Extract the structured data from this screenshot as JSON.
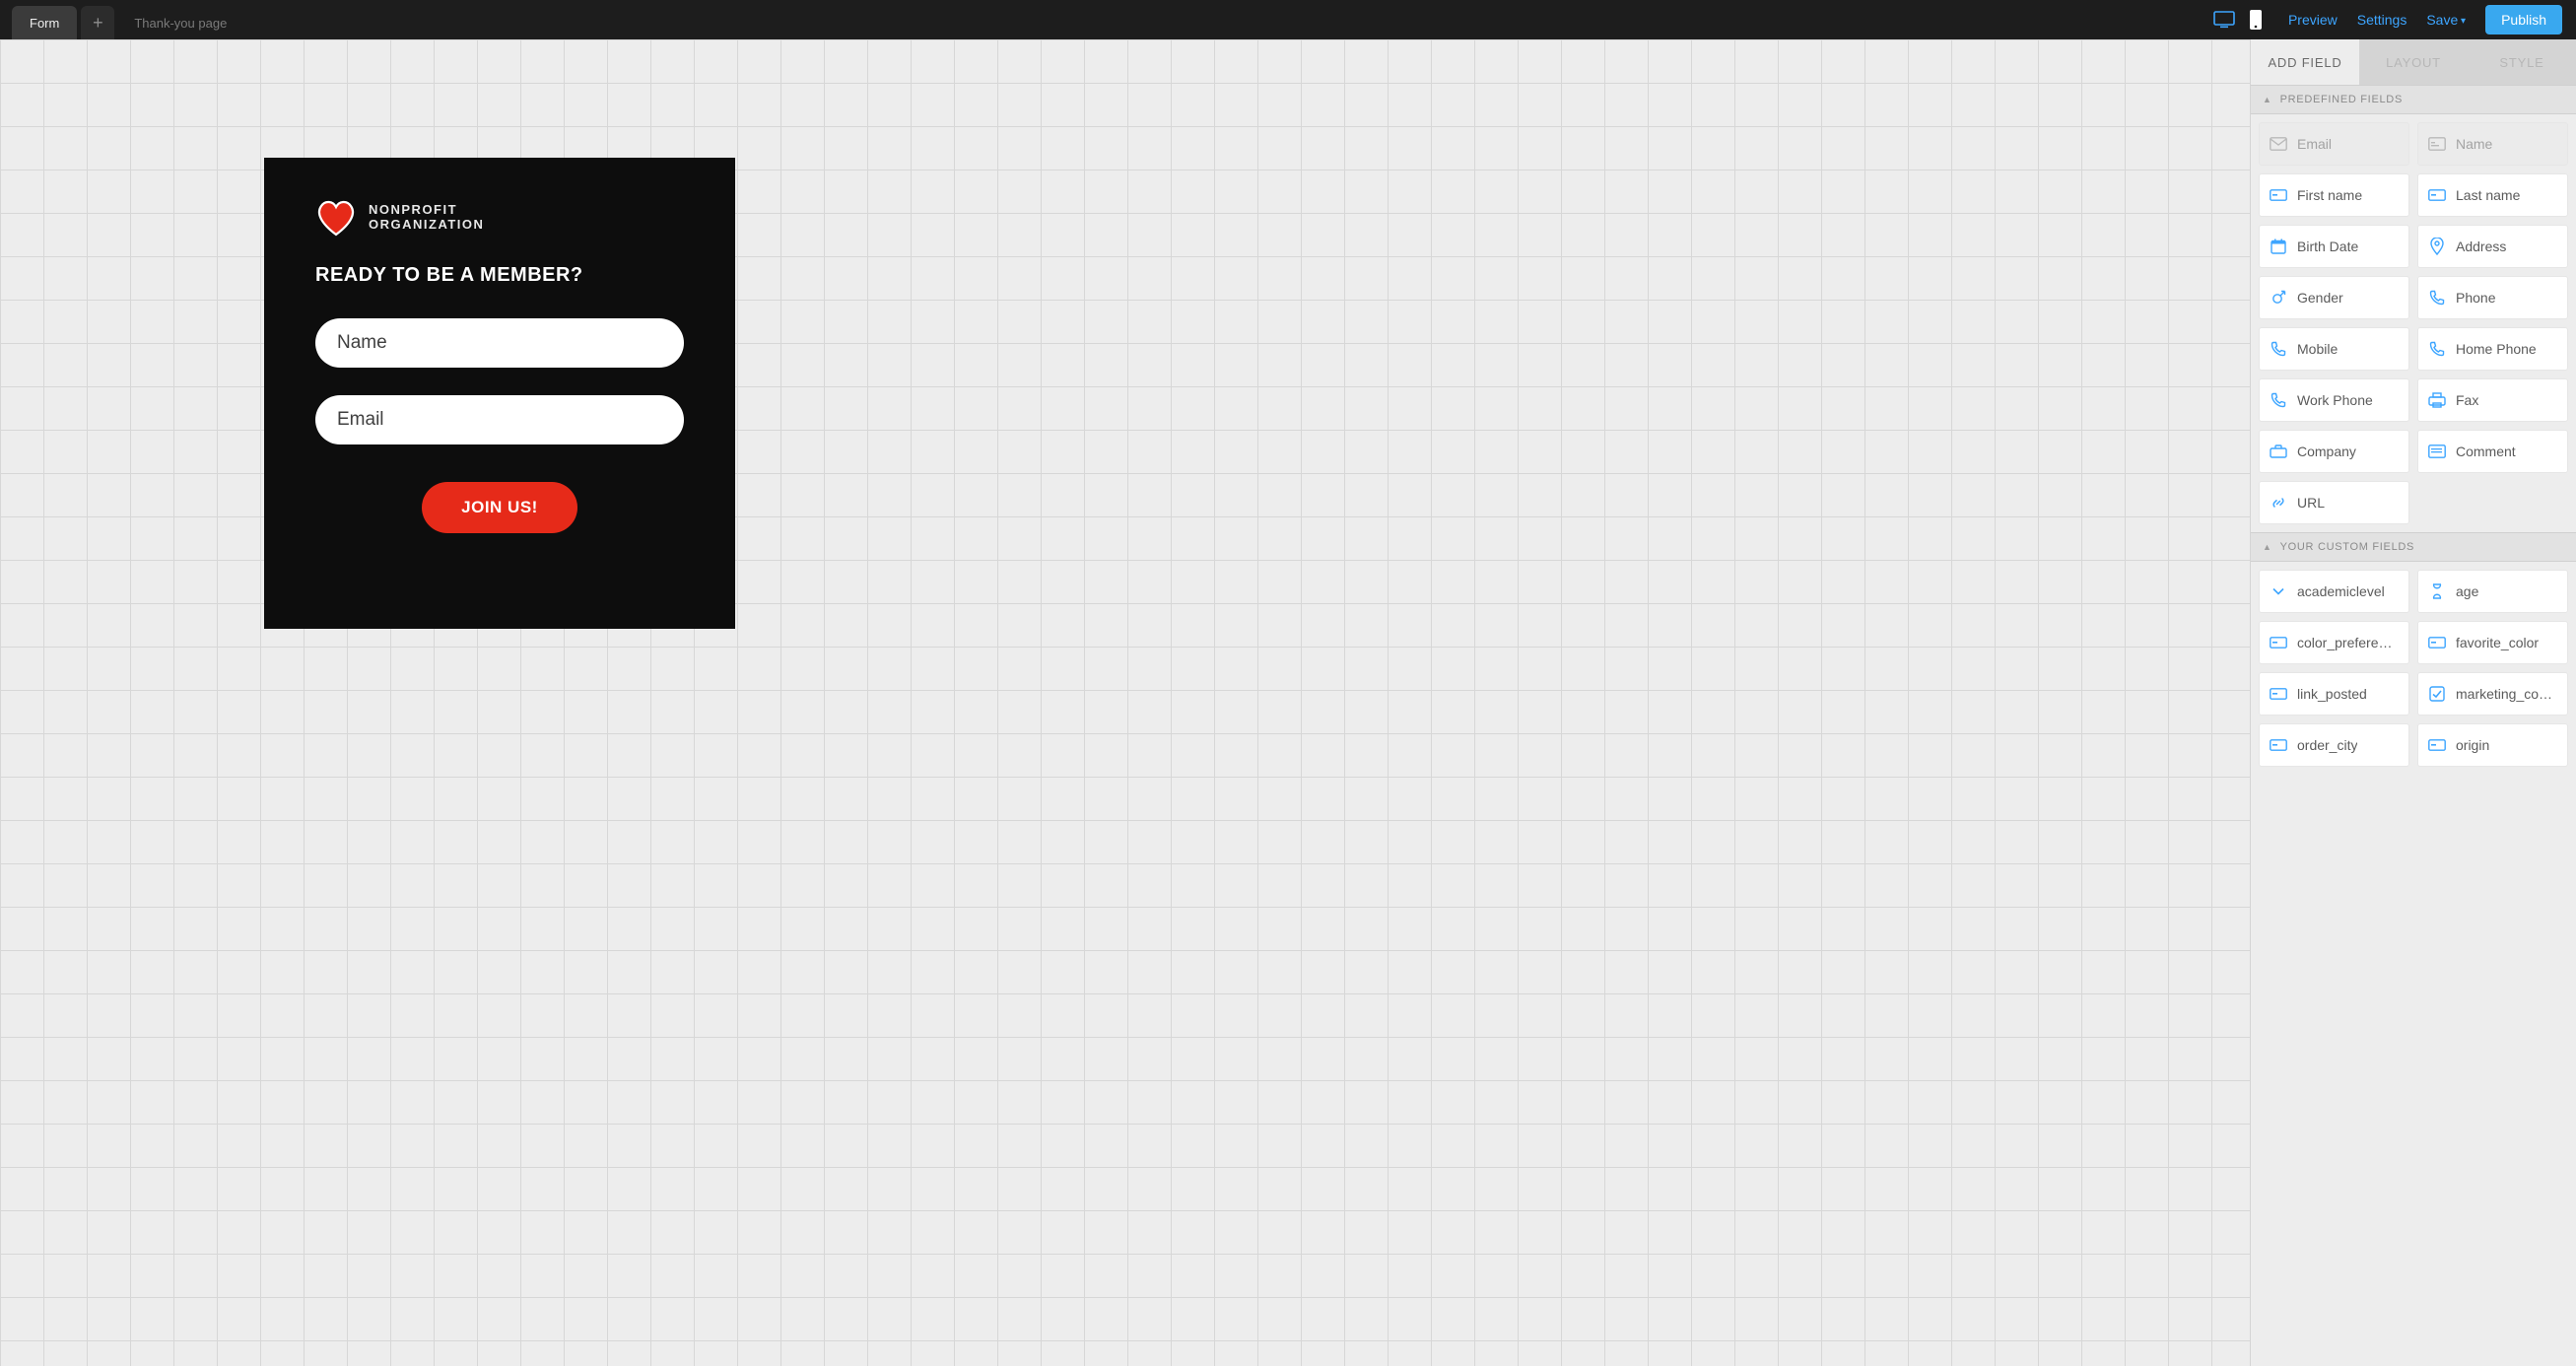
{
  "topbar": {
    "tab_form": "Form",
    "tab_thankyou": "Thank-you page",
    "preview": "Preview",
    "settings": "Settings",
    "save": "Save",
    "publish": "Publish"
  },
  "form_card": {
    "logo_line1": "NONPROFIT",
    "logo_line2": "ORGANIZATION",
    "heading": "READY TO BE A MEMBER?",
    "name_placeholder": "Name",
    "email_placeholder": "Email",
    "cta": "JOIN US!"
  },
  "panel": {
    "tabs": {
      "add_field": "ADD FIELD",
      "layout": "LAYOUT",
      "style": "STYLE"
    },
    "section_predefined": "PREDEFINED FIELDS",
    "section_custom": "YOUR CUSTOM FIELDS",
    "predefined": [
      {
        "label": "Email",
        "icon": "mail",
        "disabled": true
      },
      {
        "label": "Name",
        "icon": "id",
        "disabled": true
      },
      {
        "label": "First name",
        "icon": "text",
        "disabled": false
      },
      {
        "label": "Last name",
        "icon": "text",
        "disabled": false
      },
      {
        "label": "Birth Date",
        "icon": "calendar",
        "disabled": false
      },
      {
        "label": "Address",
        "icon": "pin",
        "disabled": false
      },
      {
        "label": "Gender",
        "icon": "gender",
        "disabled": false
      },
      {
        "label": "Phone",
        "icon": "phone",
        "disabled": false
      },
      {
        "label": "Mobile",
        "icon": "phone",
        "disabled": false
      },
      {
        "label": "Home Phone",
        "icon": "phone",
        "disabled": false
      },
      {
        "label": "Work Phone",
        "icon": "phone",
        "disabled": false
      },
      {
        "label": "Fax",
        "icon": "fax",
        "disabled": false
      },
      {
        "label": "Company",
        "icon": "company",
        "disabled": false
      },
      {
        "label": "Comment",
        "icon": "comment",
        "disabled": false
      },
      {
        "label": "URL",
        "icon": "link",
        "disabled": false
      }
    ],
    "custom": [
      {
        "label": "academiclevel",
        "icon": "chevron"
      },
      {
        "label": "age",
        "icon": "hourglass"
      },
      {
        "label": "color_preference",
        "icon": "text"
      },
      {
        "label": "favorite_color",
        "icon": "text"
      },
      {
        "label": "link_posted",
        "icon": "text"
      },
      {
        "label": "marketing_consent",
        "icon": "check"
      },
      {
        "label": "order_city",
        "icon": "text"
      },
      {
        "label": "origin",
        "icon": "text"
      }
    ]
  }
}
